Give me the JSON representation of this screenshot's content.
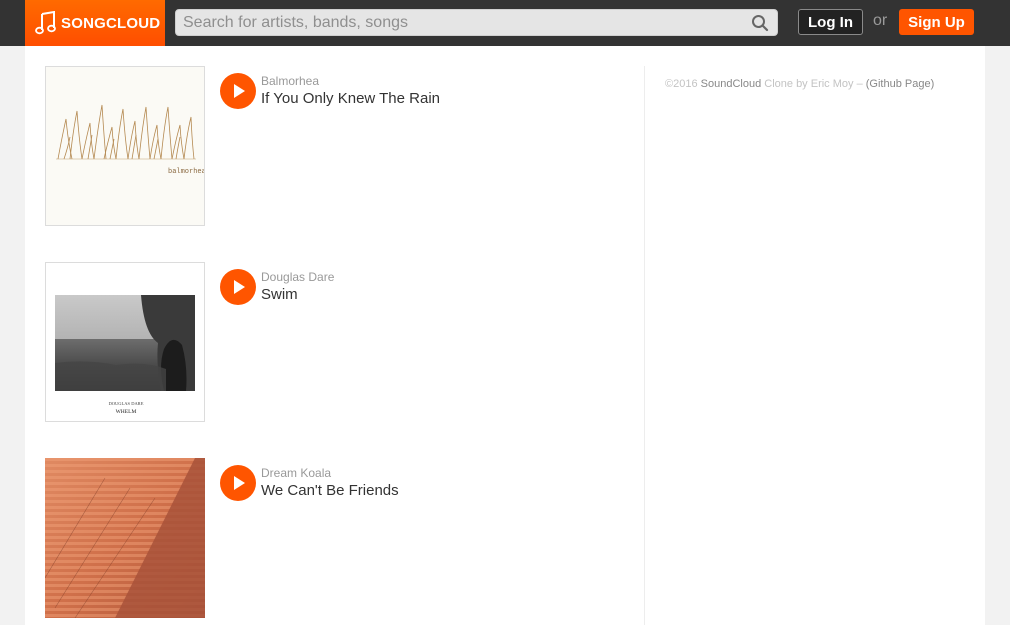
{
  "header": {
    "logo_text": "SONGCLOUD",
    "search_placeholder": "Search for artists, bands, songs",
    "login_label": "Log In",
    "or_text": "or",
    "signup_label": "Sign Up"
  },
  "tracks": [
    {
      "artist": "Balmorhea",
      "title": "If You Only Knew The Rain",
      "art_caption": "balmorhea"
    },
    {
      "artist": "Douglas Dare",
      "title": "Swim",
      "art_caption_top": "DOUGLAS DARE",
      "art_caption_bottom": "WHELM"
    },
    {
      "artist": "Dream Koala",
      "title": "We Can't Be Friends"
    }
  ],
  "footer": {
    "copyright": "©2016",
    "brand": "SoundCloud",
    "clone_by": "Clone by Eric Moy –",
    "github_link": "(Github Page)"
  },
  "colors": {
    "accent": "#ff5500",
    "header_bg": "#333333"
  }
}
